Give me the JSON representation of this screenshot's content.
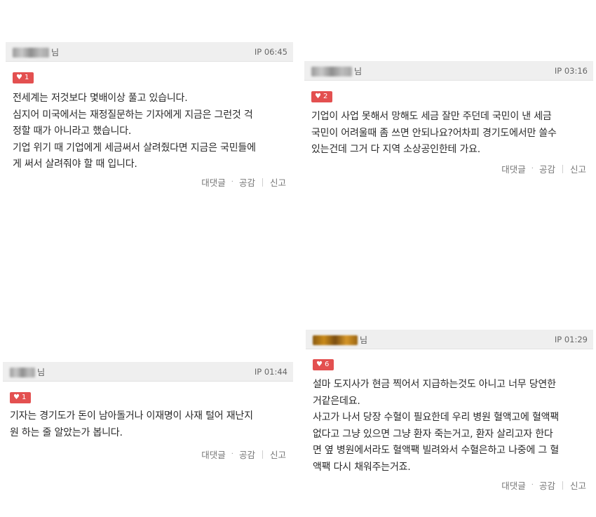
{
  "comments": [
    {
      "author_suffix": "님",
      "ip": "IP 06:45",
      "likes": "1",
      "text": "전세계는 저것보다 몇배이상 풀고 있습니다.\n심지어 미국에서는 재정질문하는 기자에게 지금은 그런것 걱\n정할 때가 아니라고 했습니다.\n기업 위기 때 기업에게 세금써서 살려줬다면 지금은 국민들에\n게 써서 살려줘야 할 때 입니다.",
      "reply": "대댓글",
      "empathy": "공감",
      "report": "신고"
    },
    {
      "author_suffix": "님",
      "ip": "IP 03:16",
      "likes": "2",
      "text": "기업이 사업 못해서 망해도 세금 잘만 주던데 국민이 낸 세금\n국민이 어려울때 좀 쓰면 안되나요?어차피 경기도에서만 쓸수\n있는건데 그거 다 지역 소상공인한테 가요.",
      "reply": "대댓글",
      "empathy": "공감",
      "report": "신고"
    },
    {
      "author_suffix": "님",
      "ip": "IP 01:44",
      "likes": "1",
      "text": "기자는 경기도가 돈이 남아돌거나 이재명이 사재 털어 재난지\n원 하는 줄 알았는가 봅니다.",
      "reply": "대댓글",
      "empathy": "공감",
      "report": "신고"
    },
    {
      "author_suffix": "님",
      "ip": "IP 01:29",
      "likes": "6",
      "text": "설마 도지사가 현금 찍어서 지급하는것도 아니고 너무 당연한\n거같은데요.\n사고가 나서 당장 수혈이 필요한데 우리 병원 혈액고에 혈액팩\n없다고 그냥 있으면 그냥 환자 죽는거고, 환자 살리고자 한다\n면 옆 병원에서라도 혈액팩 빌려와서 수혈은하고 나중에 그 혈\n액팩 다시 채워주는거죠.",
      "reply": "대댓글",
      "empathy": "공감",
      "report": "신고"
    }
  ],
  "icons": {
    "like": "heart-icon"
  },
  "colors": {
    "like_badge": "#e35050",
    "header_bg": "#efefef"
  }
}
